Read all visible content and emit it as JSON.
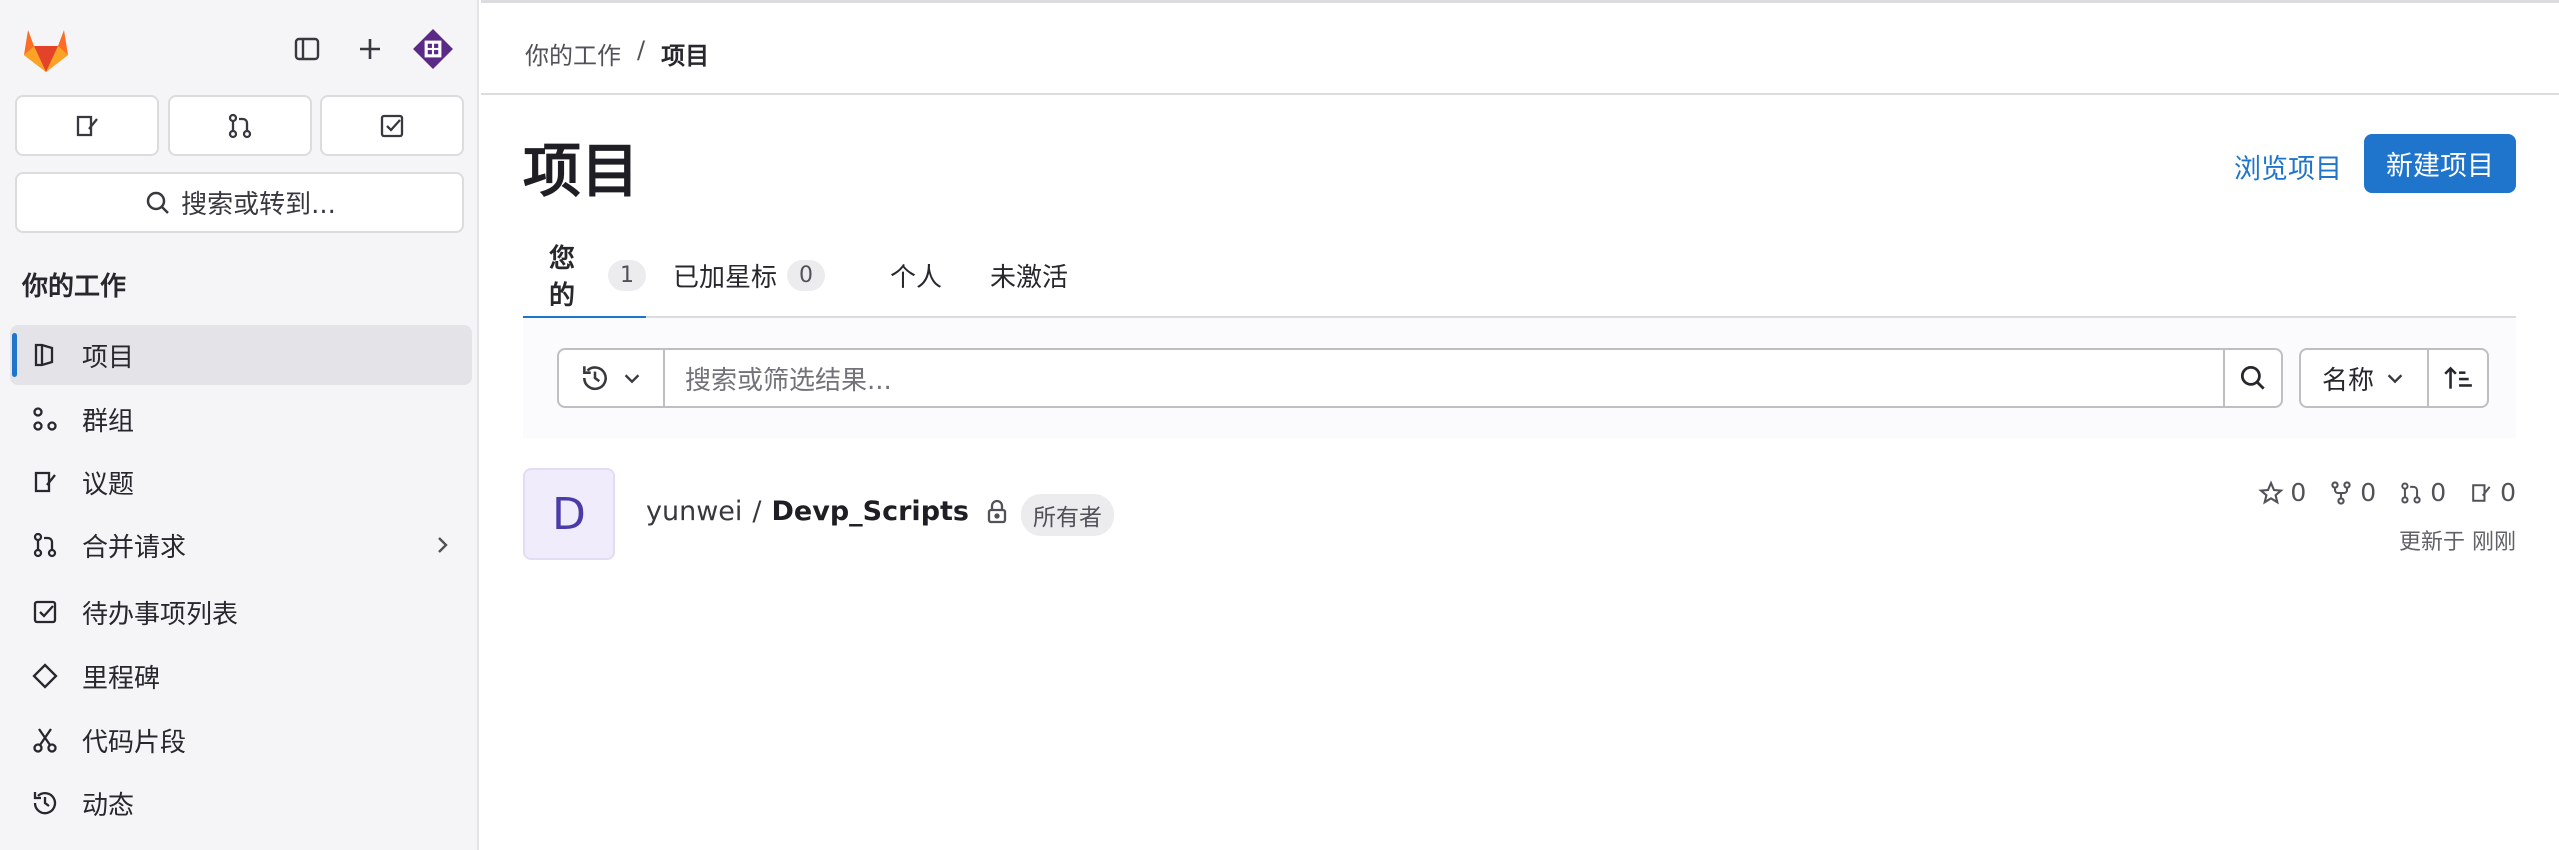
{
  "sidebar": {
    "section_title": "你的工作",
    "search_label": "搜索或转到...",
    "items": [
      {
        "label": "项目",
        "icon": "project-icon",
        "active": true
      },
      {
        "label": "群组",
        "icon": "group-icon"
      },
      {
        "label": "议题",
        "icon": "issues-icon"
      },
      {
        "label": "合并请求",
        "icon": "merge-request-icon"
      },
      {
        "label": "待办事项列表",
        "icon": "todo-icon"
      },
      {
        "label": "里程碑",
        "icon": "milestone-icon"
      },
      {
        "label": "代码片段",
        "icon": "snippet-icon"
      },
      {
        "label": "动态",
        "icon": "history-icon"
      }
    ]
  },
  "breadcrumb": {
    "parent": "你的工作",
    "separator": "/",
    "current": "项目"
  },
  "page": {
    "title": "项目",
    "explore_label": "浏览项目",
    "new_project_label": "新建项目"
  },
  "tabs": [
    {
      "label": "您的",
      "count": "1",
      "active": true
    },
    {
      "label": "已加星标",
      "count": "0"
    },
    {
      "label": "个人"
    },
    {
      "label": "未激活"
    }
  ],
  "filter": {
    "placeholder": "搜索或筛选结果...",
    "sort_label": "名称"
  },
  "projects": [
    {
      "avatar_letter": "D",
      "namespace": "yunwei",
      "separator": "/",
      "name": "Devp_Scripts",
      "role": "所有者",
      "stars": "0",
      "forks": "0",
      "merge_requests": "0",
      "issues": "0",
      "updated": "更新于 刚刚"
    }
  ],
  "colors": {
    "accent": "#1f75cb",
    "sidebar_bg": "#f5f5f7",
    "avatar_bg": "#f0ecfb"
  }
}
